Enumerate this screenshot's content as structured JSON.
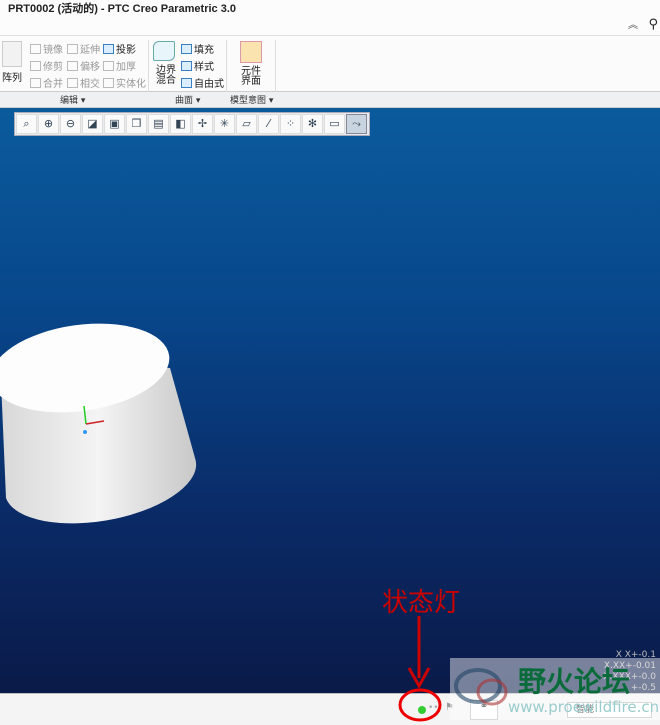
{
  "window": {
    "title": "PRT0002 (活动的) - PTC Creo Parametric 3.0"
  },
  "ribbon": {
    "edit": {
      "pattern": "阵列",
      "mirror": "镜像",
      "extend": "延伸",
      "project": "投影",
      "trim": "修剪",
      "offset": "偏移",
      "thicken": "加厚",
      "merge": "合并",
      "intersect": "相交",
      "solidify": "实体化"
    },
    "surface": {
      "boundary": "边界\n混合",
      "fill": "填充",
      "style": "样式",
      "freestyle": "自由式"
    },
    "intent": {
      "component_interface": "元件\n界面"
    },
    "groups": {
      "edit": "编辑 ▾",
      "surface": "曲面 ▾",
      "intent": "模型意图 ▾"
    }
  },
  "view_toolbar": {
    "buttons": [
      "refit",
      "zoom-in",
      "zoom-out",
      "repaint",
      "display-style",
      "saved-orientations",
      "view-manager",
      "perspective",
      "spin-center",
      "datum-display",
      "plane-display",
      "axis-display",
      "point-display",
      "csys-display",
      "annotation-display",
      "axis-tags"
    ],
    "active": "axis-tags"
  },
  "viewport": {
    "coords": [
      "X X+-0.1",
      "X.XX+-0.01",
      "X.XXX+-0.0",
      "+-0.5"
    ]
  },
  "annotation": {
    "label": "状态灯",
    "color": "#cc0000"
  },
  "status": {
    "light_color": "#33cc33",
    "smart_filter": "智能"
  },
  "watermark": {
    "name": "野火论坛",
    "url": "www.proewildfire.cn"
  }
}
